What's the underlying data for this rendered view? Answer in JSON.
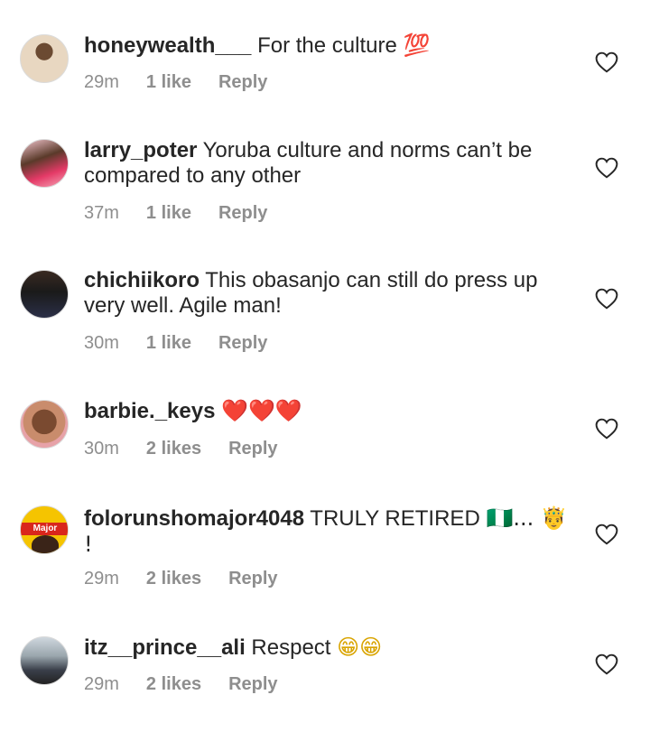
{
  "comments": [
    {
      "username": "honeywealth___",
      "text": " For the culture ",
      "emoji": "💯",
      "time": "29m",
      "likes": "1 like",
      "reply": "Reply",
      "avatar": "user-avatar"
    },
    {
      "username": "larry_poter",
      "text": " Yoruba culture and norms can’t be compared to any other",
      "time": "37m",
      "likes": "1 like",
      "reply": "Reply",
      "avatar": "user-avatar"
    },
    {
      "username": "chichiikoro",
      "text": " This obasanjo can still do press up very well. Agile man!",
      "time": "30m",
      "likes": "1 like",
      "reply": "Reply",
      "avatar": "user-avatar"
    },
    {
      "username": "barbie._keys",
      "text": " ",
      "emoji": "❤️❤️❤️",
      "time": "30m",
      "likes": "2 likes",
      "reply": "Reply",
      "avatar": "user-avatar"
    },
    {
      "username": "folorunshomajor4048",
      "text": " TRULY RETIRED ",
      "emoji": "🇳🇬... 🤴 !",
      "avatar_text": "Major",
      "time": "29m",
      "likes": "2 likes",
      "reply": "Reply",
      "avatar": "user-avatar"
    },
    {
      "username": "itz__prince__ali",
      "text": " Respect ",
      "emoji": "😁😁",
      "time": "29m",
      "likes": "2 likes",
      "reply": "Reply",
      "avatar": "user-avatar"
    }
  ],
  "icons": {
    "like": "heart-outline-icon"
  },
  "colors": {
    "text": "#262626",
    "meta": "#8e8e8e"
  }
}
